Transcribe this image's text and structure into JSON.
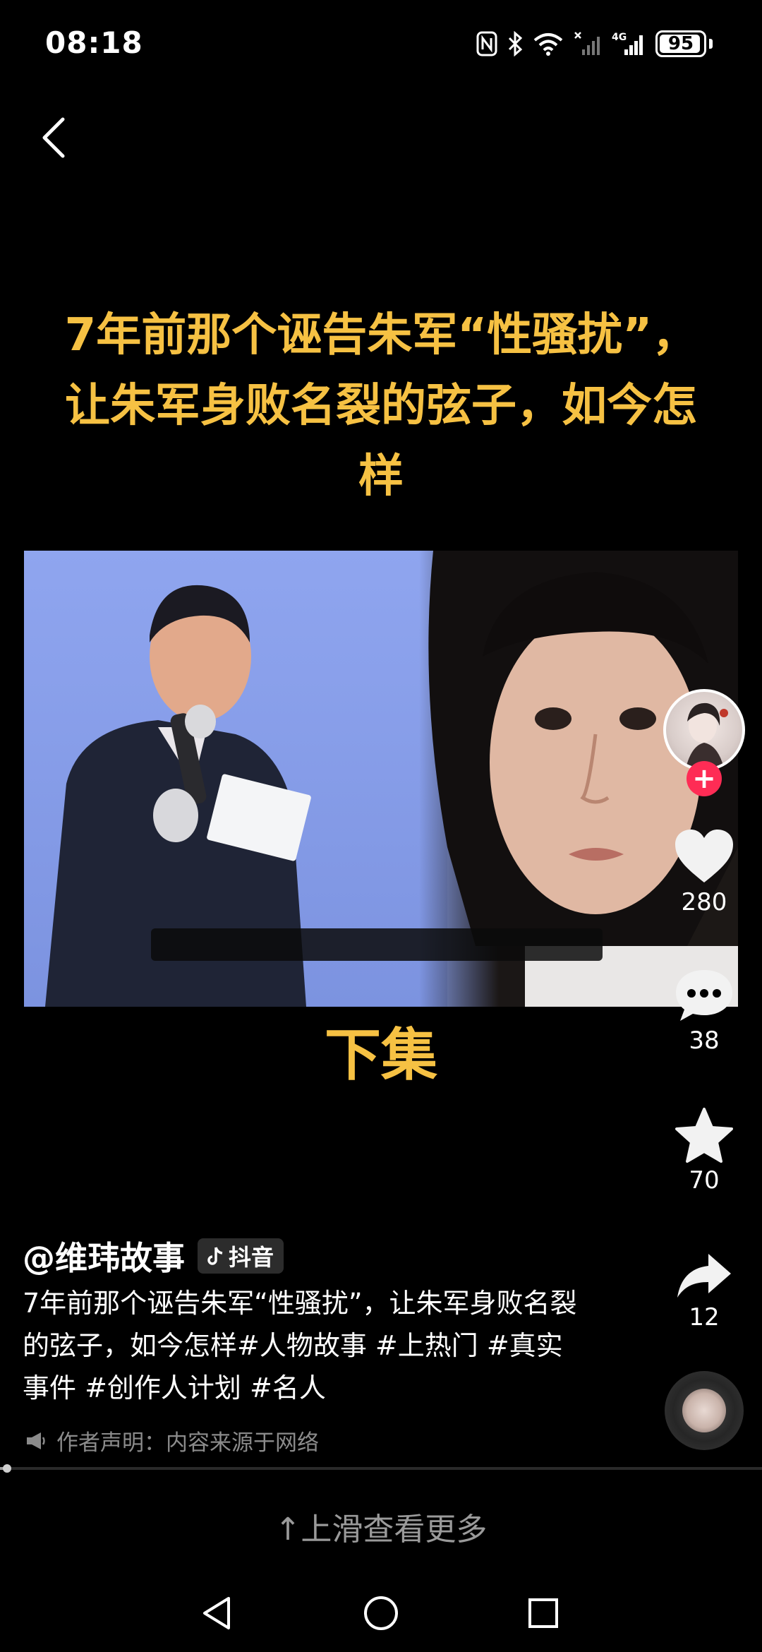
{
  "status_bar": {
    "time": "08:18",
    "network_label": "4G",
    "battery": 95,
    "icons": [
      "nfc-icon",
      "bluetooth-icon",
      "wifi-icon",
      "signal-no-sim-icon",
      "signal-4g-icon",
      "battery-icon"
    ]
  },
  "video": {
    "headline": "7年前那个诬告朱军“性骚扰”，让朱军身败名裂的弦子，如今怎样",
    "episode_label": "下集",
    "progress": 0.006
  },
  "actions": {
    "like_count": "280",
    "comment_count": "38",
    "favorite_count": "70",
    "share_count": "12",
    "follow_symbol": "+"
  },
  "author": {
    "name": "@维玮故事",
    "platform_badge": "抖音"
  },
  "description": "7年前那个诬告朱军“性骚扰”，让朱军身败名裂的弦子，如今怎样#人物故事 #上热门 #真实事件 #创作人计划 #名人",
  "disclaimer": "作者声明：内容来源于网络",
  "swipe_hint": "↑上滑查看更多",
  "colors": {
    "accent_yellow": "#f6c143",
    "follow_red": "#fe2c55",
    "muted_text": "#8b8b8b"
  }
}
